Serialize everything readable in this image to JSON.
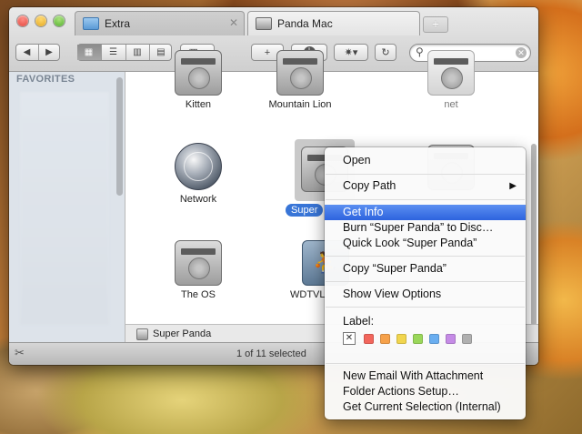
{
  "window": {
    "tabs": [
      {
        "label": "Extra"
      },
      {
        "label": "Panda Mac"
      }
    ],
    "toolbar": {
      "back": "◀",
      "forward": "▶",
      "new_folder": "+",
      "info": "i",
      "action": "✷▾",
      "refresh": "↻",
      "search_placeholder": ""
    },
    "sidebar": {
      "header": "FAVORITES"
    },
    "items": [
      {
        "name": "Kitten",
        "icon": "hard-drive-icon"
      },
      {
        "name": "Mountain Lion",
        "icon": "hard-drive-icon"
      },
      {
        "name": "net",
        "icon": "hard-drive-icon"
      },
      {
        "name": "Network",
        "icon": "network-globe-icon"
      },
      {
        "name": "Super",
        "icon": "hard-drive-icon",
        "selected": true
      },
      {
        "name": "The OS",
        "icon": "hard-drive-icon"
      },
      {
        "name": "WDTVL",
        "icon": "wdtv-share-icon"
      }
    ],
    "path_bar": "Super Panda",
    "status": "1 of 11 selected"
  },
  "context_menu": {
    "items": [
      {
        "label": "Open"
      },
      {
        "label": "Copy Path",
        "submenu": true
      },
      {
        "label": "Get Info",
        "highlighted": true
      },
      {
        "label": "Burn “Super Panda” to Disc…"
      },
      {
        "label": "Quick Look “Super Panda”"
      },
      {
        "label": "Copy “Super Panda”"
      },
      {
        "label": "Show View Options"
      },
      {
        "label": "Label:"
      },
      {
        "label": "New Email With Attachment"
      },
      {
        "label": "Folder Actions Setup…"
      },
      {
        "label": "Get Current Selection (Internal)"
      }
    ],
    "label_colors": [
      "#f2665c",
      "#f6a14a",
      "#f1d54e",
      "#9ad75a",
      "#6aaef0",
      "#c58be6",
      "#b0b0b0"
    ]
  }
}
